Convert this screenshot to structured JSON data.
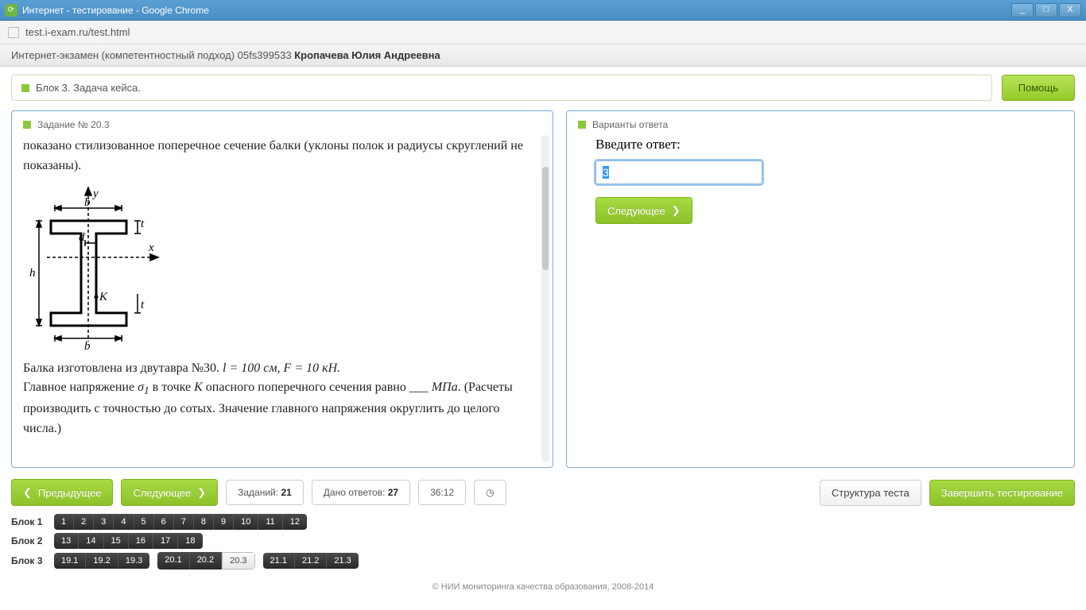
{
  "window": {
    "title": "Интернет - тестирование - Google Chrome",
    "min": "_",
    "max": "□",
    "close": "X"
  },
  "url": "test.i-exam.ru/test.html",
  "header": {
    "prefix": "Интернет-экзамен (компетентностный подход) 05fs399533 ",
    "name": "Кропачева Юлия Андреевна"
  },
  "infobar": "Блок 3. Задача кейса.",
  "help": "Помощь",
  "task": {
    "title": "Задание № 20.3",
    "p1": "показано стилизованное поперечное сечение балки (уклоны полок и радиусы скруглений не показаны).",
    "labels": {
      "y": "y",
      "x": "x",
      "b_top": "b",
      "b_bot": "b",
      "t": "t",
      "d": "d",
      "h": "h",
      "K": "K"
    },
    "p2_a": "Балка изготовлена из двутавра №30. ",
    "p2_b": "l = 100 см, F = 10 кН.",
    "p3_a": "Главное напряжение ",
    "p3_sigma": "σ",
    "p3_sub": "1",
    "p3_b": " в точке ",
    "p3_K": "K",
    "p3_c": " опасного поперечного сечения равно ___ ",
    "p3_mpa": "МПа",
    "p3_d": ". (Расчеты производить с точностью до сотых. Значение главного напряжения округлить до целого числа.)"
  },
  "answer": {
    "panel_title": "Варианты ответа",
    "label": "Введите ответ:",
    "value": "3",
    "next": "Следующее"
  },
  "controls": {
    "prev": "Предыдущее",
    "next": "Следующее",
    "count_label": "Заданий: ",
    "count": "21",
    "answered_label": "Дано ответов: ",
    "answered": "27",
    "time": "36:12",
    "clock": "◷",
    "structure": "Структура теста",
    "finish": "Завершить тестирование"
  },
  "blocks": {
    "b1": {
      "label": "Блок 1",
      "items": [
        "1",
        "2",
        "3",
        "4",
        "5",
        "6",
        "7",
        "8",
        "9",
        "10",
        "11",
        "12"
      ]
    },
    "b2": {
      "label": "Блок 2",
      "items": [
        "13",
        "14",
        "15",
        "16",
        "17",
        "18"
      ]
    },
    "b3": {
      "label": "Блок 3",
      "g1": [
        "19.1",
        "19.2",
        "19.3"
      ],
      "g2": [
        "20.1",
        "20.2",
        "20.3"
      ],
      "g3": [
        "21.1",
        "21.2",
        "21.3"
      ],
      "active": "20.3"
    }
  },
  "footer": "© НИИ мониторинга качества образования, 2008-2014"
}
